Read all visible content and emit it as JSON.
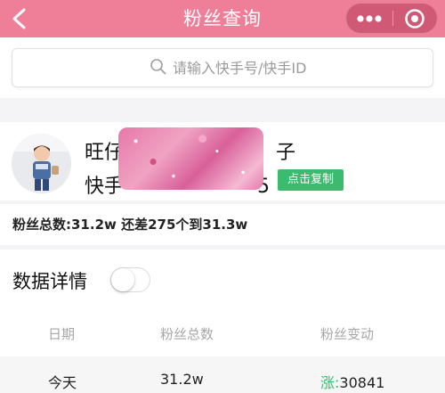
{
  "navbar": {
    "title": "粉丝查询"
  },
  "search": {
    "placeholder": "请输入快手号/快手ID"
  },
  "profile": {
    "name_visible_prefix": "旺仔",
    "name_visible_suffix": "子",
    "id_visible_prefix": "快手",
    "id_visible_suffix": "5",
    "copy_label": "点击复制"
  },
  "summary": {
    "text": "粉丝总数:31.2w 还差275个到31.3w"
  },
  "details": {
    "title": "数据详情",
    "toggle_on": false,
    "columns": [
      "日期",
      "粉丝总数",
      "粉丝变动"
    ],
    "rows": [
      {
        "date": "今天",
        "total": "31.2w",
        "change_label": "涨:",
        "change_value": "30841"
      }
    ]
  },
  "colors": {
    "navbar": "#ef7f98",
    "accent_green": "#3cba6e"
  },
  "icons": [
    "back-arrow-icon",
    "more-dots-icon",
    "close-circle-icon",
    "search-icon"
  ]
}
